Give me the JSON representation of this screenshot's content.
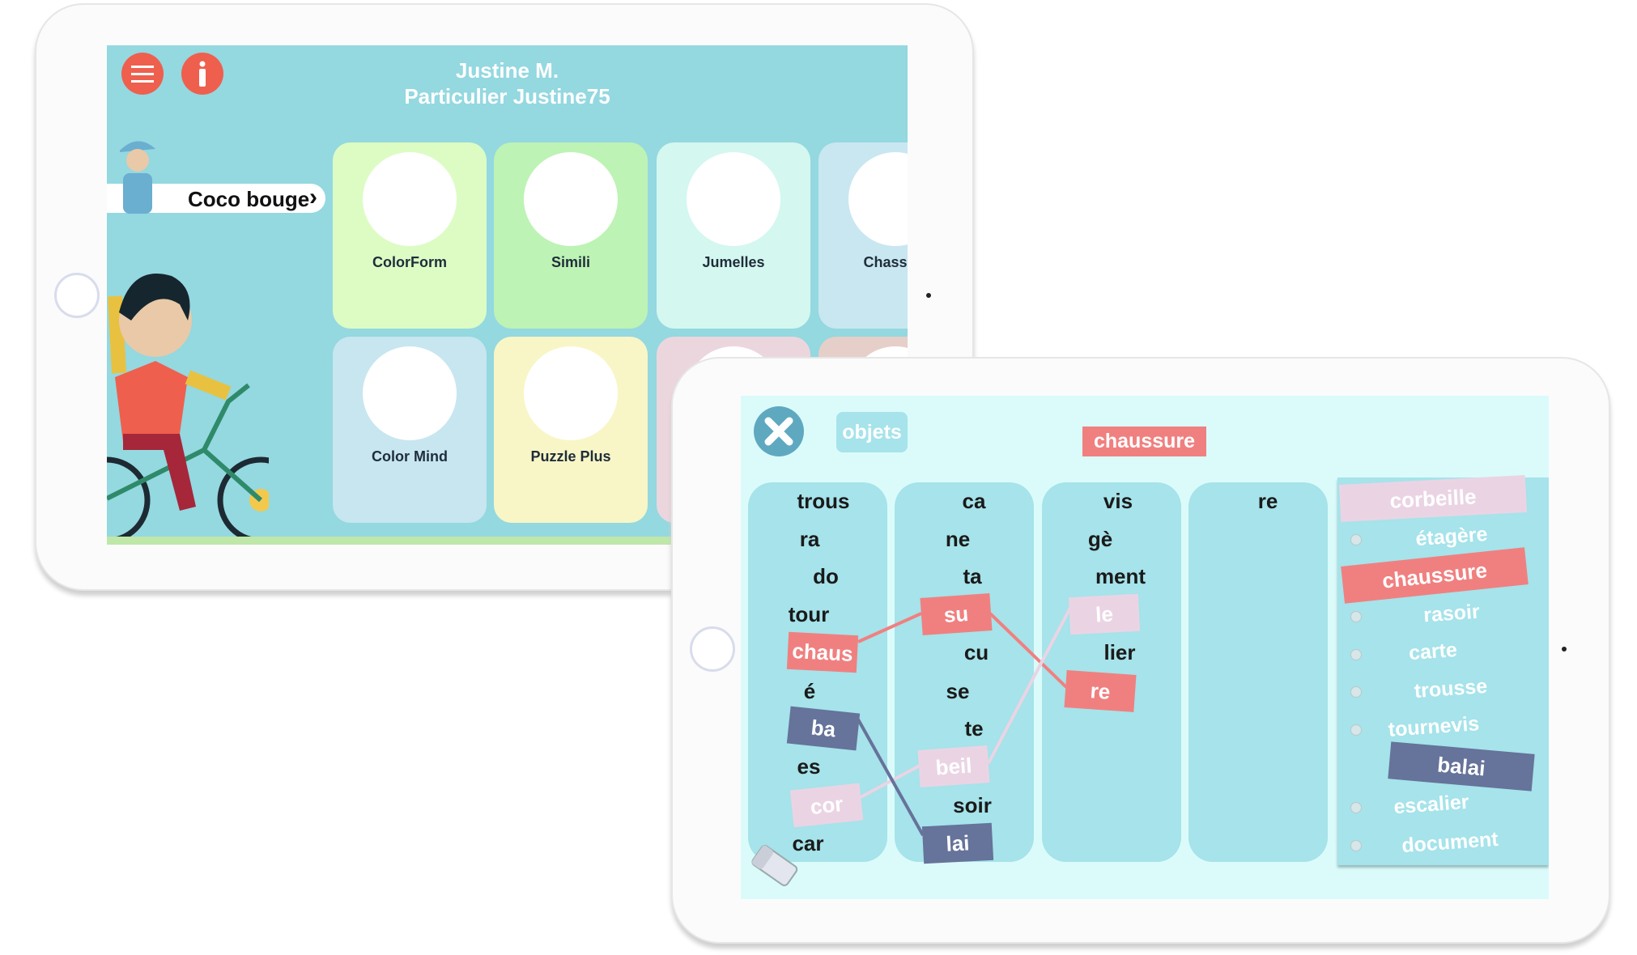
{
  "colors": {
    "accent_red": "#ef5f4e",
    "syllable_red": "#f08080",
    "syllable_pink": "#ead4e4",
    "syllable_navy": "#66739a",
    "screen1_bg": "#94d8e0",
    "screen2_bg": "#dbfbfb"
  },
  "home_screen": {
    "menu_icon": "hamburger-icon",
    "info_icon": "info-icon",
    "user_name": "Justine M.",
    "account": "Particulier Justine75",
    "featured": {
      "label": "Coco bouge",
      "chevron": "›"
    },
    "games": [
      {
        "label": "ColorForm",
        "color": "#dcfcc4"
      },
      {
        "label": "Simili",
        "color": "#bdf3b4"
      },
      {
        "label": "Jumelles",
        "color": "#d4f7f0"
      },
      {
        "label": "Chasse à",
        "color": "#c9e7f0"
      },
      {
        "label": "Color Mind",
        "color": "#c7e6f0"
      },
      {
        "label": "Puzzle Plus",
        "color": "#f8f6c6"
      },
      {
        "label": "",
        "color": "#ecd6dd"
      },
      {
        "label": "",
        "color": "#e6cfc8"
      }
    ]
  },
  "exercise_screen": {
    "close_icon": "close-icon",
    "category": "objets",
    "target_word": "chaussure",
    "columns": [
      [
        "trous",
        "ra",
        "do",
        "tour",
        "chaus",
        "é",
        "ba",
        "es",
        "cor",
        "car"
      ],
      [
        "ca",
        "ne",
        "ta",
        "su",
        "cu",
        "se",
        "te",
        "beil",
        "soir",
        "lai"
      ],
      [
        "vis",
        "gè",
        "ment",
        "le",
        "lier",
        "re"
      ],
      [
        "re"
      ]
    ],
    "word_list": [
      "corbeille",
      "étagère",
      "chaussure",
      "rasoir",
      "carte",
      "trousse",
      "tournevis",
      "balai",
      "escalier",
      "document"
    ],
    "eraser_icon": "eraser-icon"
  }
}
